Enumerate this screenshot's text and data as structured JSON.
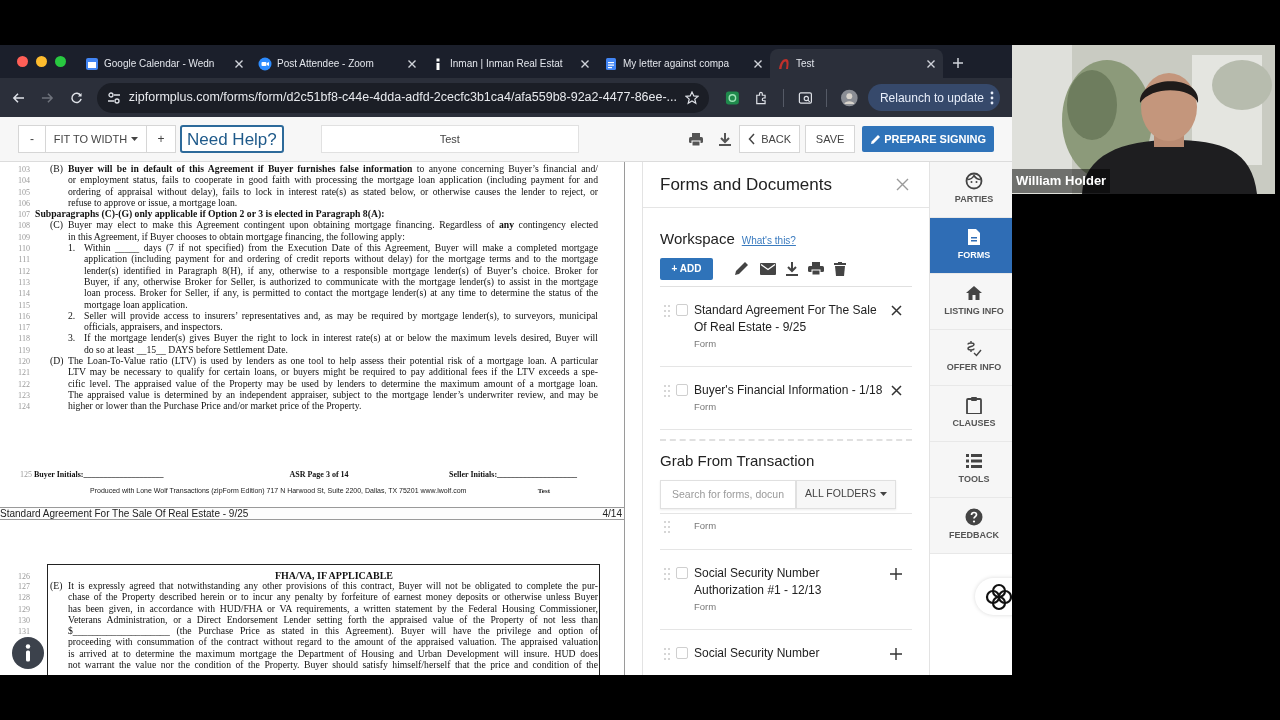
{
  "browser": {
    "tabs": [
      {
        "kind": "calendar",
        "title": "Google Calendar - Wedn",
        "selected": false
      },
      {
        "kind": "meeting",
        "title": "Post Attendee - Zoom",
        "selected": false
      },
      {
        "kind": "news",
        "title": "Inman | Inman Real Estat",
        "selected": false
      },
      {
        "kind": "doc",
        "title": "My letter against compa",
        "selected": false
      },
      {
        "kind": "app",
        "title": "Test",
        "selected": true
      }
    ],
    "url": "zipformplus.com/forms/form/d2c51bf8-c44e-4dda-adfd-2cecfc3b1ca4/afa559b8-92a2-4477-86ee-...",
    "relaunch": "Relaunch to update"
  },
  "toolbar": {
    "zoom_out": "-",
    "fit": "FIT TO WIDTH",
    "zoom_in": "+",
    "help": "Need Help?",
    "title_field": "Test",
    "back": "BACK",
    "save": "SAVE",
    "prepare": "PREPARE SIGNING"
  },
  "document": {
    "page3": {
      "lines": [
        {
          "number": "103",
          "kind": "para",
          "label": "(B)",
          "text": "**Buyer will be in default of this Agreement if Buyer furnishes false information** to anyone concerning Buyer’s financial and/"
        },
        {
          "number": "104",
          "kind": "para",
          "text": "or employment status, fails to cooperate in good faith with processing the mortgage loan application (including payment for and"
        },
        {
          "number": "105",
          "kind": "para",
          "text": "ordering of appraisal without delay), fails to lock in interest rate(s) as stated below, or otherwise causes the lender to reject, or"
        },
        {
          "number": "106",
          "kind": "para_end",
          "text": "refuse to approve or issue, a mortgage loan."
        },
        {
          "number": "107",
          "kind": "heading",
          "text": "Subparagraphs (C)-(G) only applicable if Option 2 or 3 is elected in Paragraph 8(A):"
        },
        {
          "number": "108",
          "kind": "para",
          "label": "(C)",
          "text": "Buyer may elect to make this Agreement contingent upon obtaining mortgage financing. Regardless of **any** contingency elected"
        },
        {
          "number": "109",
          "kind": "para_end",
          "text": "in this Agreement, if Buyer chooses to obtain mortgage financing, the following apply:"
        },
        {
          "number": "110",
          "kind": "item",
          "label": "1.",
          "text": "Within _____ days (7 if not specified) from the Execution Date of this Agreement, Buyer will make a completed mortgage"
        },
        {
          "number": "111",
          "kind": "item",
          "text": "application (including payment for and ordering of credit reports without delay) for the mortgage terms and to the mortgage"
        },
        {
          "number": "112",
          "kind": "item",
          "text": "lender(s) identified in Paragraph 8(H), if any, otherwise to a responsible mortgage lender(s) of Buyer’s choice. Broker for"
        },
        {
          "number": "113",
          "kind": "item",
          "text": "Buyer, if any, otherwise Broker for Seller, is authorized to communicate with the mortgage lender(s) to assist in the mortgage"
        },
        {
          "number": "114",
          "kind": "item",
          "text": "loan process. Broker for Seller, if any, is permitted to contact the mortgage lender(s) at any time to determine the status of the"
        },
        {
          "number": "115",
          "kind": "item_end",
          "text": "mortgage loan application."
        },
        {
          "number": "116",
          "kind": "item",
          "label": "2.",
          "text": "Seller will provide access to insurers’ representatives and, as may be required by mortgage lender(s), to surveyors, municipal"
        },
        {
          "number": "117",
          "kind": "item_end",
          "text": "officials, appraisers, and inspectors."
        },
        {
          "number": "118",
          "kind": "item",
          "label": "3.",
          "text": "If the mortgage lender(s) gives Buyer the right to lock in interest rate(s) at or below the maximum levels desired, Buyer will"
        },
        {
          "number": "119",
          "kind": "item_end",
          "text": "do so at least __15__ DAYS before Settlement Date."
        },
        {
          "number": "120",
          "kind": "para",
          "label": "(D)",
          "text": "The Loan-To-Value ratio (LTV) is used by lenders as one tool to help assess their potential risk of a mortgage loan. A particular"
        },
        {
          "number": "121",
          "kind": "para",
          "text": "LTV may be necessary to qualify for certain loans, or buyers might be required to pay additional fees if the LTV exceeds a spe-"
        },
        {
          "number": "122",
          "kind": "para",
          "text": "cific level. The appraised value of the Property may be used by lenders to determine the maximum amount of a mortgage loan."
        },
        {
          "number": "123",
          "kind": "para",
          "text": "The appraised value is determined by an independent appraiser, subject to the mortgage lender’s underwriter review, and may be"
        },
        {
          "number": "124",
          "kind": "para_end",
          "text": "higher or lower than the Purchase Price and/or market price of the Property."
        }
      ],
      "footer": {
        "number": "125",
        "buyer_initials": "Buyer Initials:____________________",
        "page": "ASR Page 3 of 14",
        "seller_initials": "Seller Initials:____________________",
        "produced": "Produced with Lone Wolf Transactions (zipForm Edition) 717 N Harwood St, Suite 2200, Dallas, TX 75201  www.lwolf.com",
        "form_name": "Test"
      }
    },
    "page_label": {
      "title": "Standard Agreement For The Sale Of Real Estate - 9/25",
      "page": "4/14"
    },
    "page4": {
      "title_number": "126",
      "title": "FHA/VA, IF APPLICABLE",
      "lines": [
        {
          "number": "127",
          "kind": "para",
          "label": "(E)",
          "text": "It is expressly agreed that notwithstanding any other provisions of this contract, Buyer will not be obligated to complete the pur-"
        },
        {
          "number": "128",
          "kind": "para",
          "text": "chase of the Property described herein or to incur any penalty by forfeiture of earnest money deposits or otherwise unless Buyer"
        },
        {
          "number": "129",
          "kind": "para",
          "text": "has been given, in accordance with HUD/FHA or VA requirements, a written statement by the Federal Housing Commissioner,"
        },
        {
          "number": "130",
          "kind": "para",
          "text": "Veterans Administration, or a Direct Endorsement Lender setting forth the appraised value of the Property of not less than"
        },
        {
          "number": "131",
          "kind": "para",
          "text": "$____________________ (the Purchase Price as stated in this Agreement). Buyer will have the privilege and option of"
        },
        {
          "kind": "para",
          "text": "proceeding with consummation of the contract without regard to the amount of the appraised valuation. The appraised valuation"
        },
        {
          "kind": "para",
          "text": "is arrived at to determine the maximum mortgage the Department of Housing and Urban Development will insure.  HUD does"
        },
        {
          "kind": "para",
          "text": "not warrant the value nor the condition of the Property. Buyer should satisfy himself/herself that the price and condition of the"
        }
      ]
    }
  },
  "panel": {
    "title": "Forms and Documents",
    "workspace": {
      "title": "Workspace",
      "help_link": "What's this?",
      "add": "+ ADD",
      "items": [
        {
          "title": "Standard Agreement For The Sale Of Real Estate - 9/25",
          "type": "Form",
          "checked": false
        },
        {
          "title": "Buyer's Financial Information - 1/18",
          "type": "Form",
          "checked": false
        }
      ]
    },
    "transaction": {
      "title": "Grab From Transaction",
      "search_placeholder": "Search for forms, docun",
      "folders": "ALL FOLDERS",
      "items": [
        {
          "type": "Form"
        },
        {
          "title": "Social Security Number Authorization #1 - 12/13",
          "type": "Form",
          "checked": false
        },
        {
          "title": "Social Security Number",
          "checked": false
        }
      ]
    }
  },
  "sidebar": {
    "items": [
      {
        "kind": "parties",
        "label": "PARTIES",
        "selected": false
      },
      {
        "kind": "forms",
        "label": "FORMS",
        "selected": true
      },
      {
        "kind": "listing",
        "label": "LISTING INFO",
        "selected": false
      },
      {
        "kind": "offer",
        "label": "OFFER INFO",
        "selected": false
      },
      {
        "kind": "clauses",
        "label": "CLAUSES",
        "selected": false
      },
      {
        "kind": "tools",
        "label": "TOOLS",
        "selected": false
      },
      {
        "kind": "feedback",
        "label": "FEEDBACK",
        "selected": false
      }
    ]
  },
  "video": {
    "kind": "picture",
    "name": "William Holder"
  }
}
